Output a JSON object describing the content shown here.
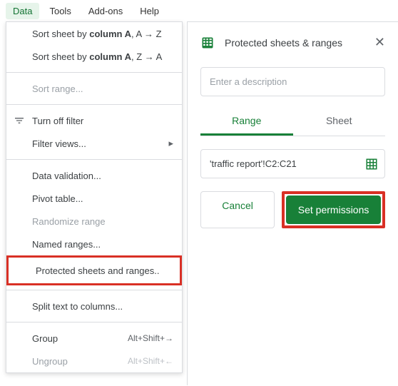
{
  "menubar": {
    "data": "Data",
    "tools": "Tools",
    "addons": "Add-ons",
    "help": "Help"
  },
  "menu": {
    "sort_az_pre": "Sort sheet by ",
    "sort_col": "column A",
    "sort_az_post": ", A → Z",
    "sort_za_post": ", Z → A",
    "sort_range": "Sort range...",
    "turn_off_filter": "Turn off filter",
    "filter_views": "Filter views...",
    "data_validation": "Data validation...",
    "pivot_table": "Pivot table...",
    "randomize": "Randomize range",
    "named_ranges": "Named ranges...",
    "protected": "Protected sheets and ranges..",
    "split_text": "Split text to columns...",
    "group": "Group",
    "group_shortcut": "Alt+Shift+→",
    "ungroup": "Ungroup",
    "ungroup_shortcut": "Alt+Shift+←"
  },
  "panel": {
    "title": "Protected sheets & ranges",
    "description_placeholder": "Enter a description",
    "tab_range": "Range",
    "tab_sheet": "Sheet",
    "range_value": "'traffic report'!C2:C21",
    "cancel": "Cancel",
    "set_permissions": "Set permissions"
  }
}
